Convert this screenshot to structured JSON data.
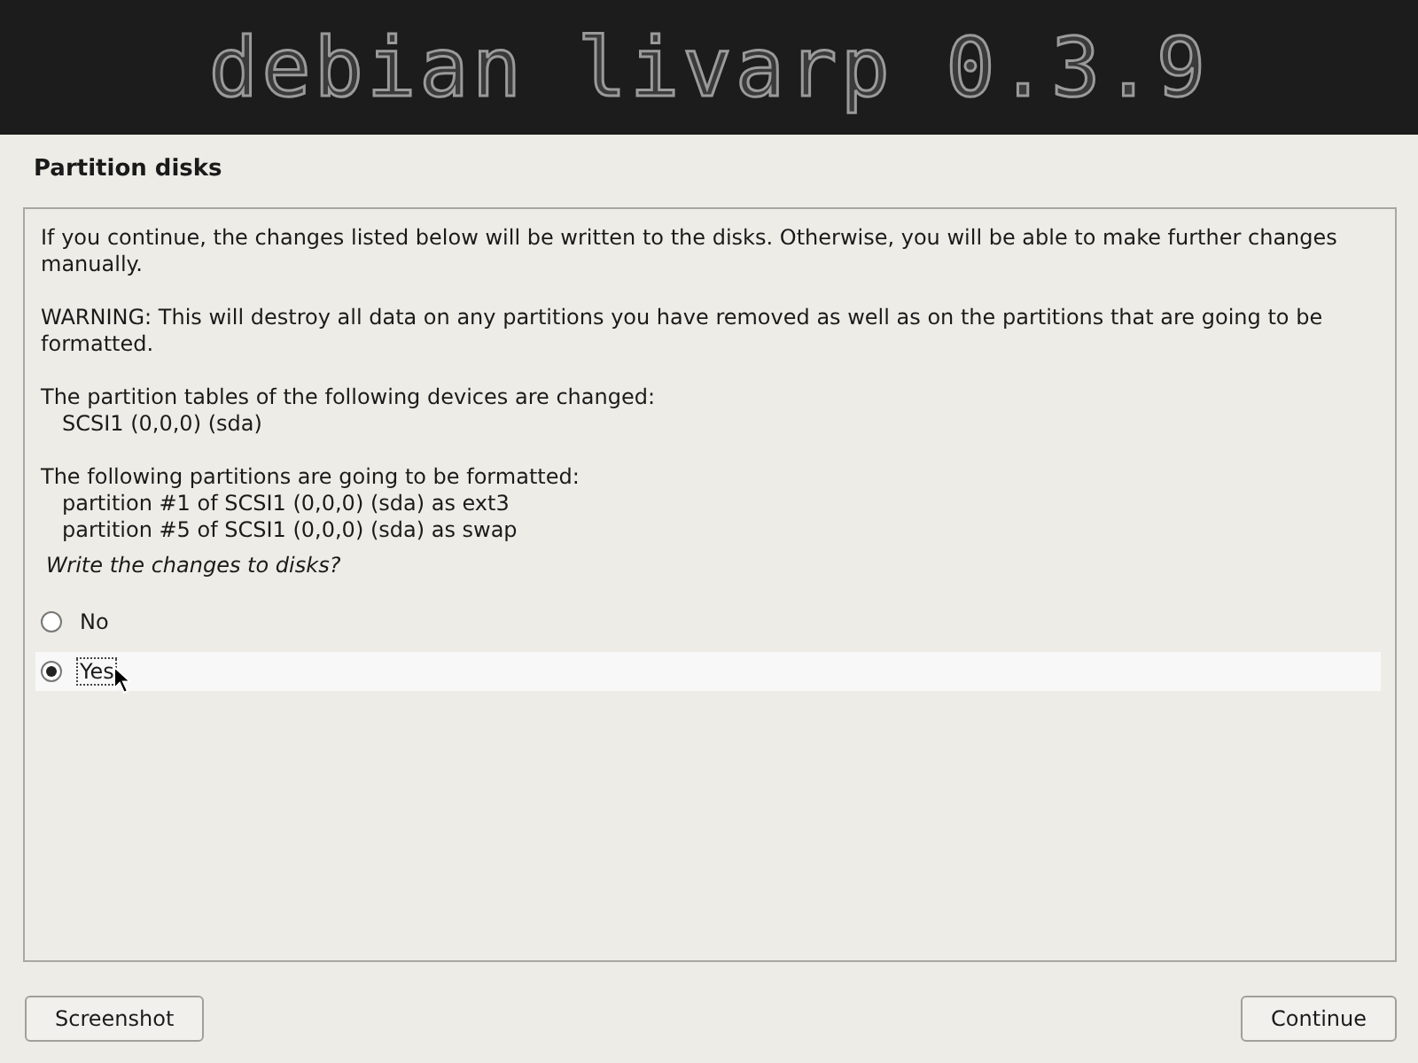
{
  "banner": {
    "logo": "debian livarp 0.3.9"
  },
  "title": "Partition disks",
  "message": [
    {
      "text": "If you continue, the changes listed below will be written to the disks. Otherwise, you will be able to make further changes manually."
    },
    {
      "text": "WARNING: This will destroy all data on any partitions you have removed as well as on the partitions that are going to be formatted."
    },
    {
      "text": "The partition tables of the following devices are changed:",
      "items": [
        "SCSI1 (0,0,0) (sda)"
      ]
    },
    {
      "text": "The following partitions are going to be formatted:",
      "items": [
        "partition #1 of SCSI1 (0,0,0) (sda) as ext3",
        "partition #5 of SCSI1 (0,0,0) (sda) as swap"
      ]
    }
  ],
  "question": "Write the changes to disks?",
  "options": [
    {
      "label": "No",
      "selected": false
    },
    {
      "label": "Yes",
      "selected": true
    }
  ],
  "buttons": [
    {
      "label": "Screenshot"
    },
    {
      "label": "Continue"
    }
  ]
}
